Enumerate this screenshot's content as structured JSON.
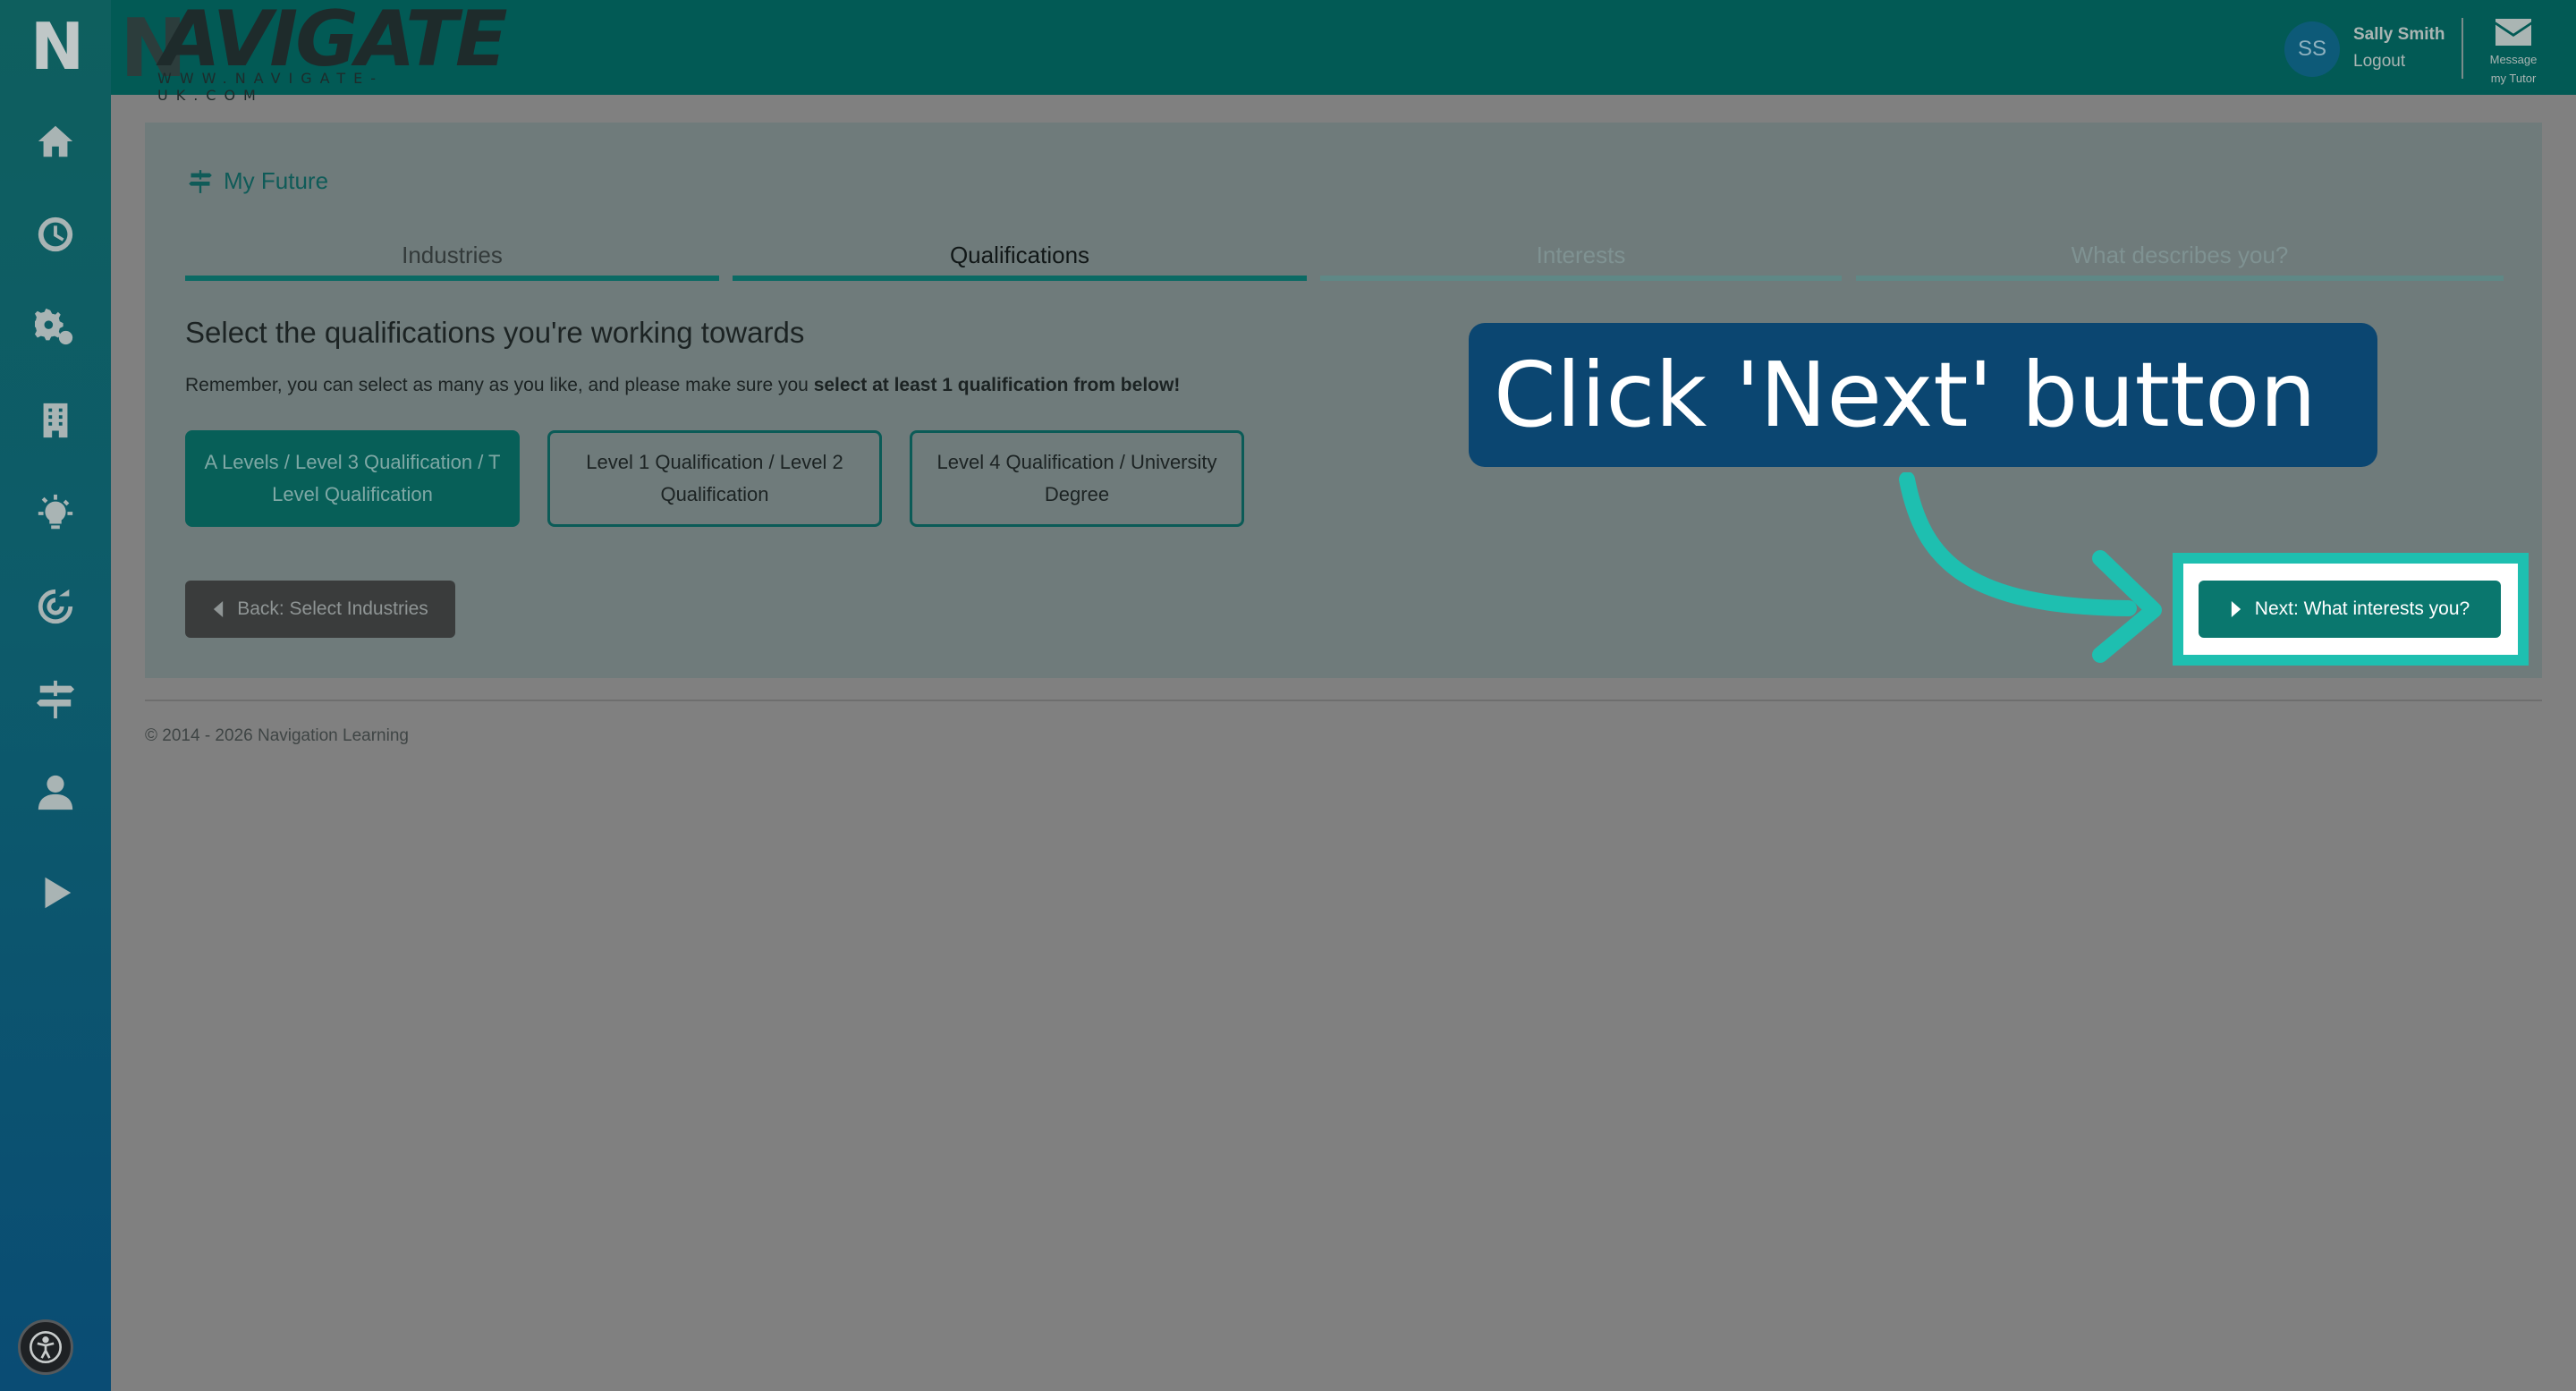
{
  "app": {
    "logo_letter": "N",
    "brand_name": "AVIGATE",
    "brand_initial": "N",
    "brand_tagline": "WWW.NAVIGATE-UK.COM"
  },
  "sidebar": {
    "icons": [
      "home-icon",
      "clock-icon",
      "gears-icon",
      "building-icon",
      "lightbulb-icon",
      "target-icon",
      "signpost-icon",
      "user-icon",
      "play-icon"
    ],
    "accessibility_icon": "accessibility-icon"
  },
  "header": {
    "avatar_initials": "SS",
    "user_name": "Sally Smith",
    "logout_label": "Logout",
    "message_label_1": "Message",
    "message_label_2": "my Tutor"
  },
  "page": {
    "breadcrumb": "My Future",
    "steps": [
      {
        "label": "Industries",
        "state": "done"
      },
      {
        "label": "Qualifications",
        "state": "current"
      },
      {
        "label": "Interests",
        "state": "todo"
      },
      {
        "label": "What describes you?",
        "state": "todo"
      }
    ],
    "title": "Select the qualifications you're working towards",
    "description_plain": "Remember, you can select as many as you like, and please make sure you ",
    "description_bold": "select at least 1 qualification from below!",
    "options": [
      {
        "label": "A Levels / Level 3 Qualification / T Level Qualification",
        "selected": true
      },
      {
        "label": "Level 1 Qualification / Level 2 Qualification",
        "selected": false
      },
      {
        "label": "Level 4 Qualification / University Degree",
        "selected": false
      }
    ],
    "back_button": "Back: Select Industries",
    "next_button": "Next: What interests you?"
  },
  "footer": {
    "copyright": "© 2014 - 2026 Navigation Learning"
  },
  "tutorial": {
    "callout_text": "Click 'Next' button"
  },
  "colors": {
    "header": "#025a55",
    "accent": "#0a776e",
    "callout": "#0b4671",
    "highlight": "#1ebfb0"
  }
}
